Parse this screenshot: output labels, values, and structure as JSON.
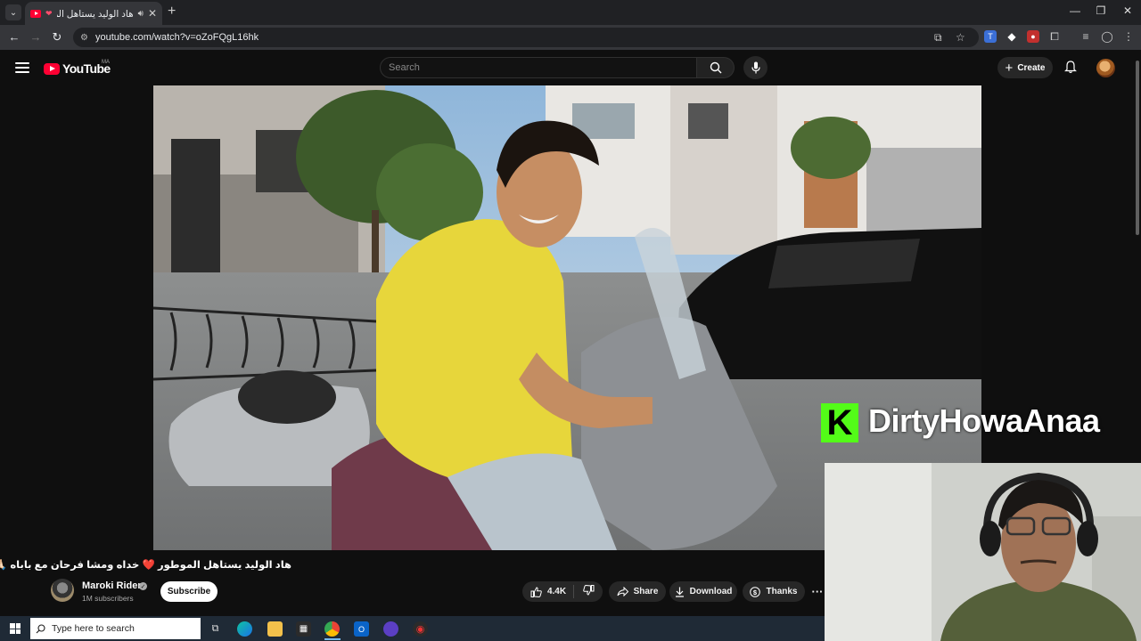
{
  "browser": {
    "tab_title": "هاد الوليد يستاهل الموطور ❤️ خداه ومشا فرحان مع باباه",
    "tab_close": "✕",
    "new_tab": "+",
    "window_controls": [
      "—",
      "❐",
      "✕"
    ],
    "url": "youtube.com/watch?v=oZoFQgL16hk"
  },
  "youtube": {
    "logo_text": "YouTube",
    "country_code": "MA",
    "search_placeholder": "Search",
    "create_label": "Create"
  },
  "video": {
    "title": "هاد الوليد يستاهل الموطور ❤️ خداه ومشا فرحان مع باباه 🙏🏻",
    "channel_name": "Maroki Rider",
    "subscribers": "1M subscribers",
    "subscribe_label": "Subscribe",
    "likes": "4.4K",
    "share_label": "Share",
    "download_label": "Download",
    "thanks_label": "Thanks",
    "more_label": "···"
  },
  "stream_overlay": {
    "kick_logo": "K",
    "username": "DirtyHowaAnaa",
    "kick_color": "#53fc18"
  },
  "taskbar": {
    "search_placeholder": "Type here to search"
  },
  "colors": {
    "youtube_red": "#ff0033",
    "background": "#0f0f0f",
    "taskbar": "#1f2a36"
  }
}
